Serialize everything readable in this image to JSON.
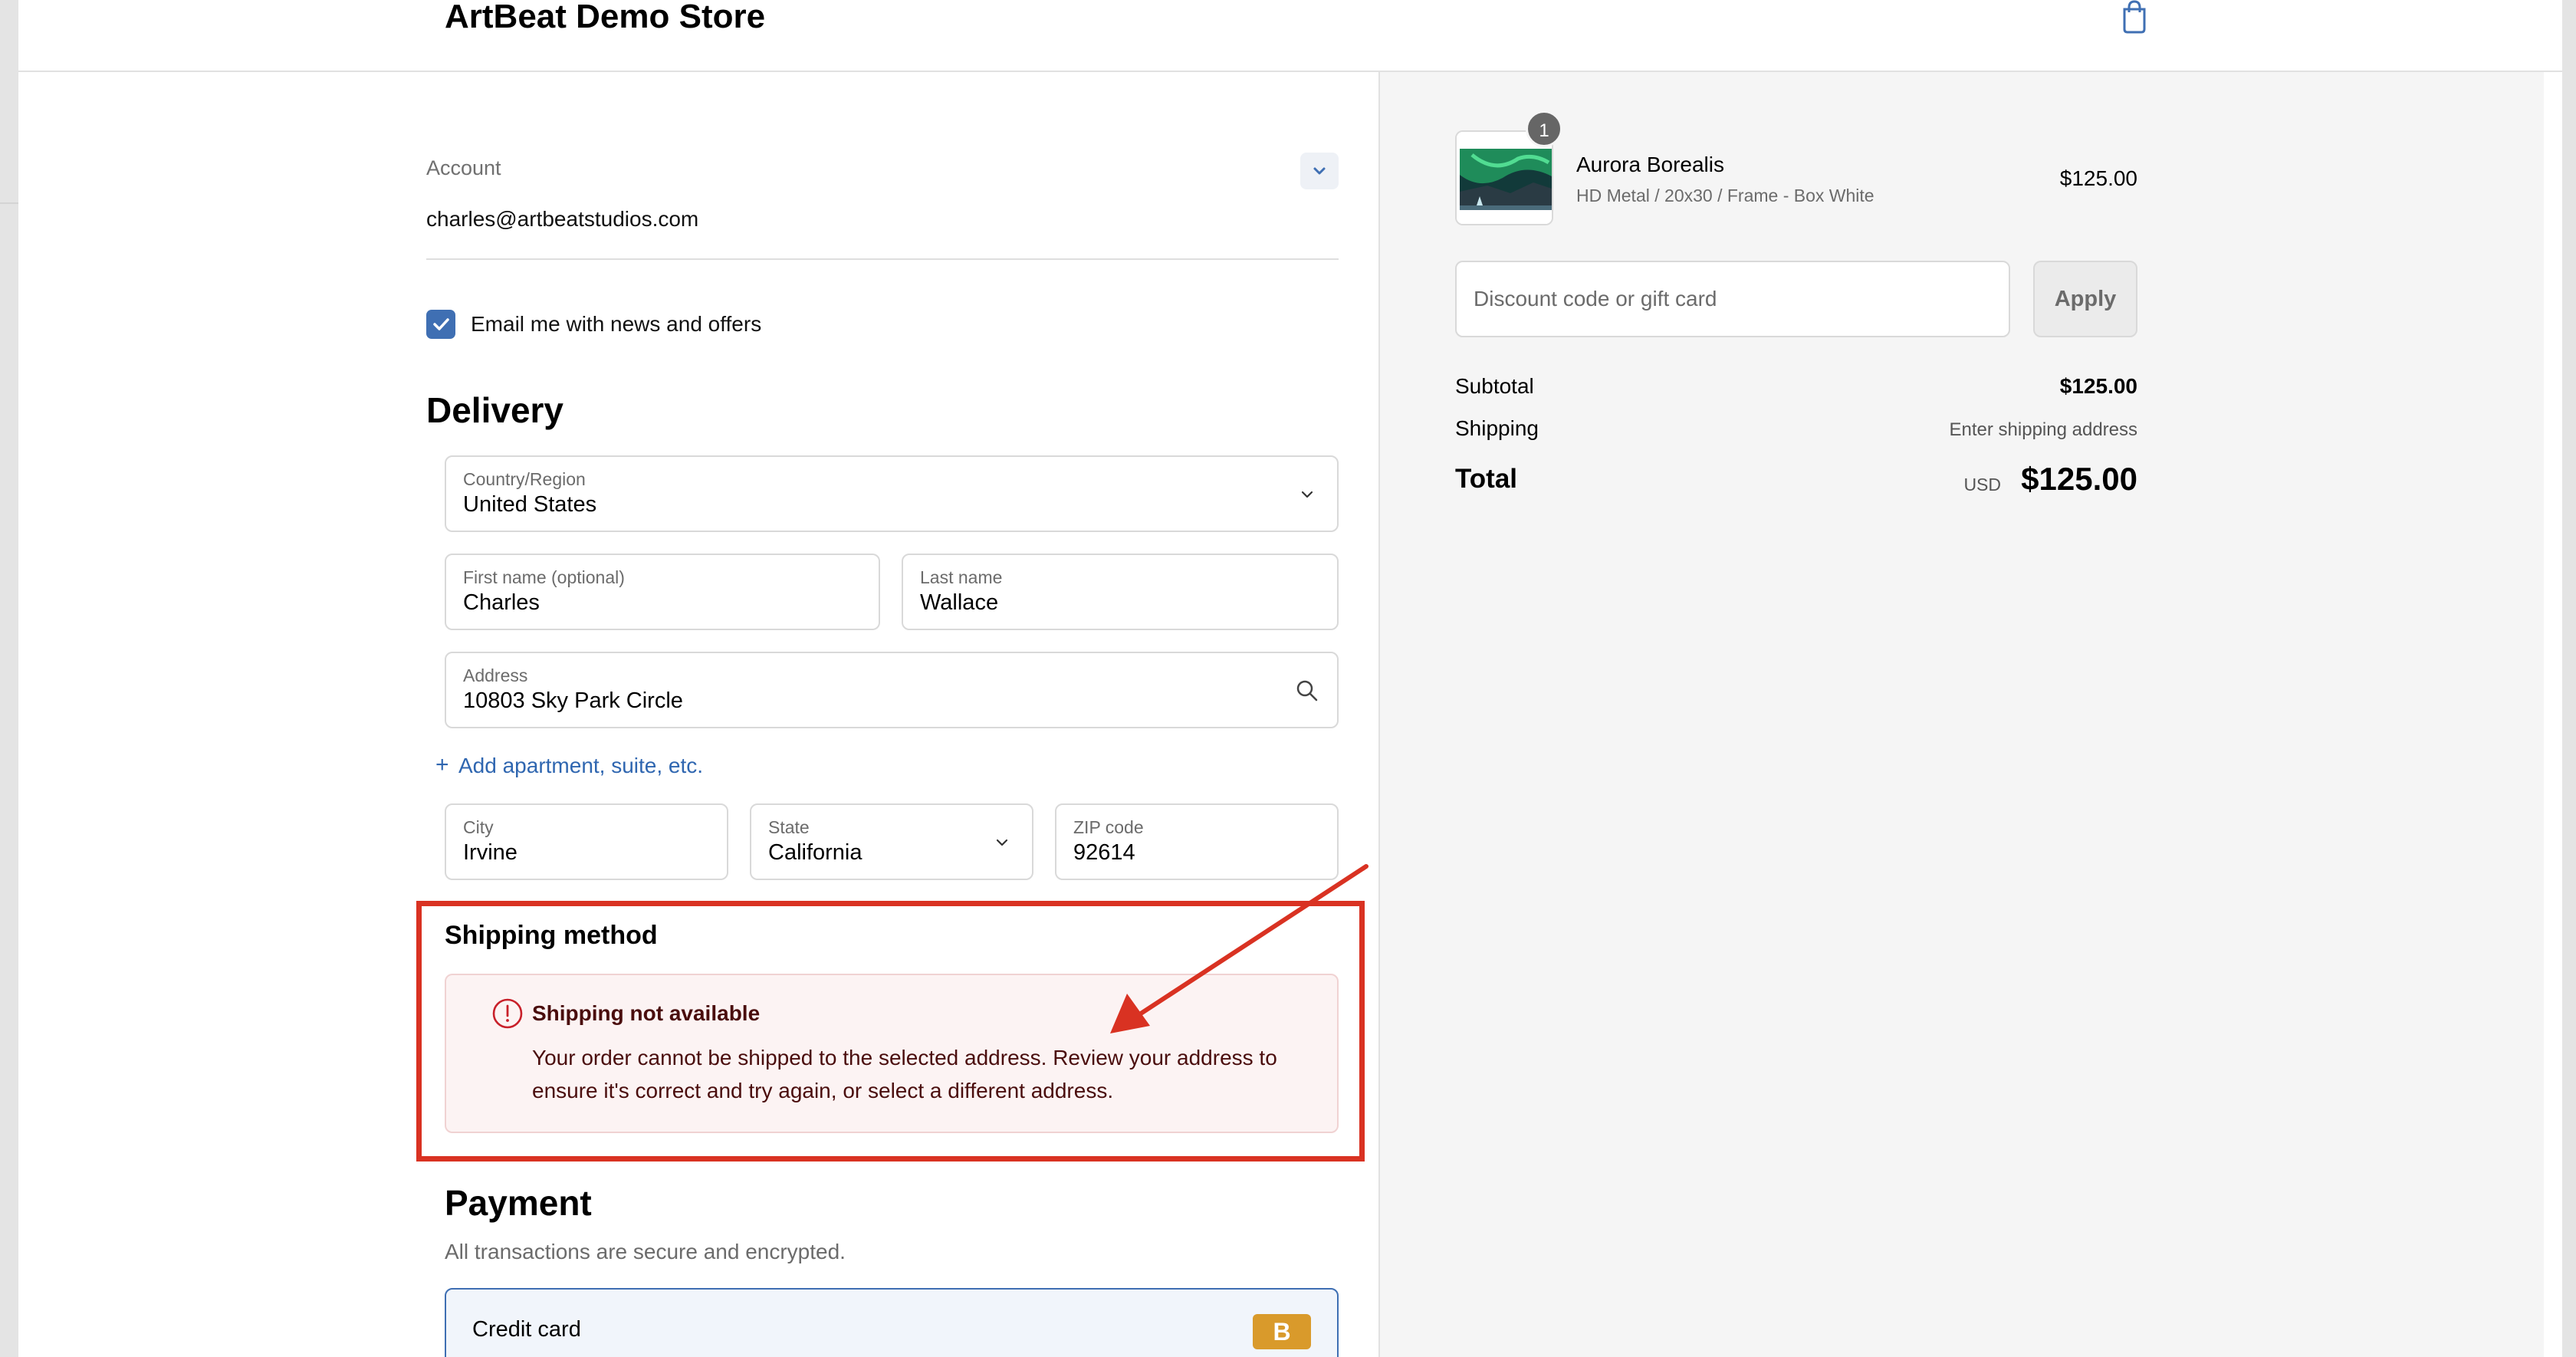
{
  "header": {
    "store_name": "ArtBeat Demo Store",
    "cart_icon": "shopping-bag-icon"
  },
  "account": {
    "label": "Account",
    "email": "charles@artbeatstudios.com",
    "marketing_opt_in_label": "Email me with news and offers",
    "marketing_opt_in_checked": true
  },
  "delivery": {
    "title": "Delivery",
    "country": {
      "label": "Country/Region",
      "value": "United States"
    },
    "first_name": {
      "label": "First name (optional)",
      "value": "Charles"
    },
    "last_name": {
      "label": "Last name",
      "value": "Wallace"
    },
    "address": {
      "label": "Address",
      "value": "10803 Sky Park Circle"
    },
    "add_apartment": "Add apartment, suite, etc.",
    "city": {
      "label": "City",
      "value": "Irvine"
    },
    "state": {
      "label": "State",
      "value": "California"
    },
    "zip": {
      "label": "ZIP code",
      "value": "92614"
    }
  },
  "shipping_method": {
    "title": "Shipping method",
    "error_title": "Shipping not available",
    "error_body": "Your order cannot be shipped to the selected address. Review your address to ensure it's correct and try again, or select a different address."
  },
  "payment": {
    "title": "Payment",
    "subtitle": "All transactions are secure and encrypted.",
    "credit_card_label": "Credit card",
    "card_badge": "B"
  },
  "order_summary": {
    "item": {
      "quantity": "1",
      "name": "Aurora Borealis",
      "variant": "HD Metal / 20x30 / Frame - Box White",
      "price": "$125.00"
    },
    "discount_placeholder": "Discount code or gift card",
    "apply_label": "Apply",
    "subtotal_label": "Subtotal",
    "subtotal_value": "$125.00",
    "shipping_label": "Shipping",
    "shipping_value": "Enter shipping address",
    "total_label": "Total",
    "total_currency": "USD",
    "total_value": "$125.00"
  },
  "colors": {
    "accent": "#3f6fb3",
    "error_bg": "#fcf3f3",
    "error_text": "#4a0d0d",
    "annotation": "#d93222",
    "card_badge": "#d99a2b"
  }
}
